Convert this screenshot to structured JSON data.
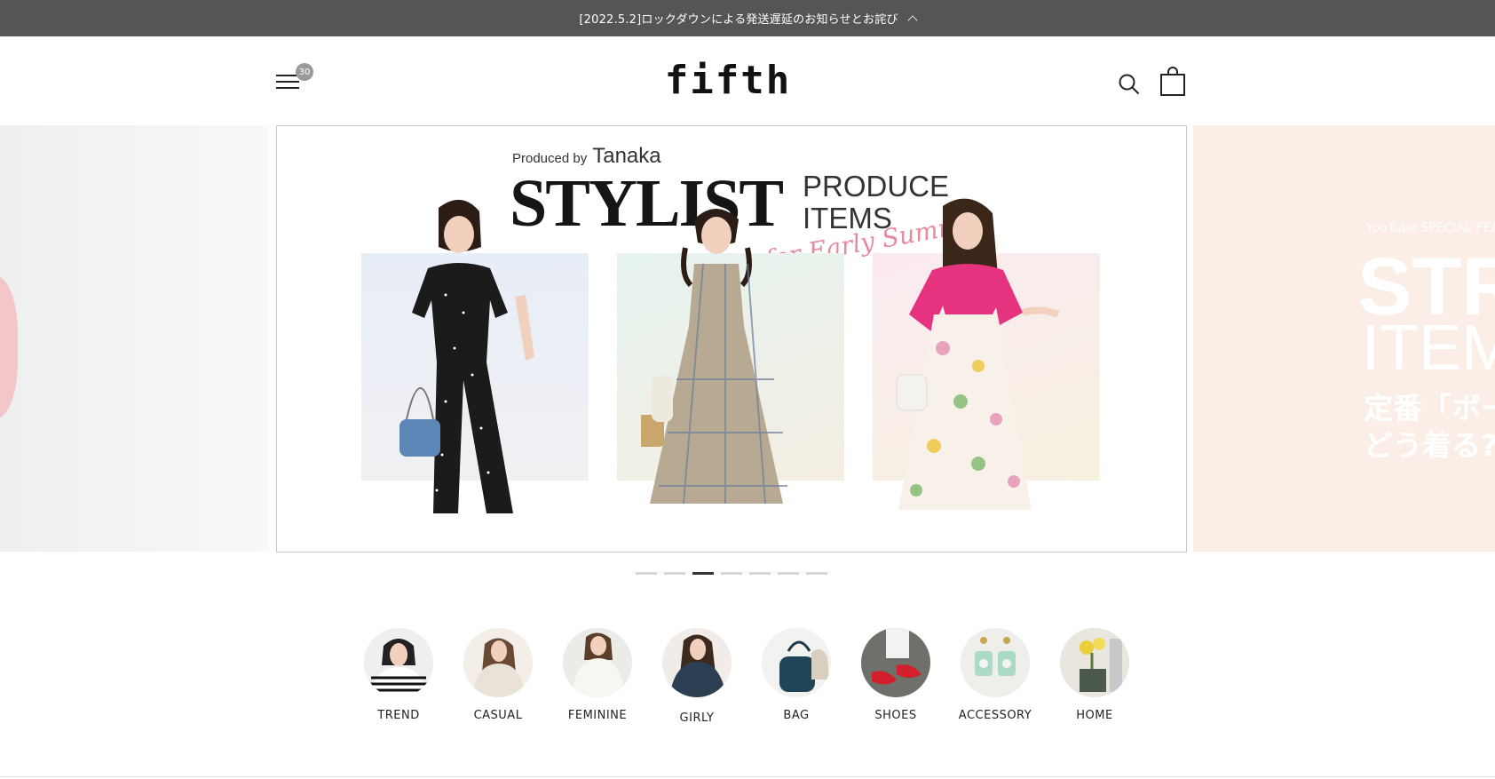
{
  "announcement": {
    "text": "[2022.5.2]ロックダウンによる発送遅延のお知らせとお詫び"
  },
  "header": {
    "logo": "fifth",
    "menu_badge": "30"
  },
  "hero": {
    "produced_by": "Produced by",
    "producer": "Tanaka",
    "headline": "STYLIST",
    "sub_1": "PRODUCE",
    "sub_2": "ITEMS",
    "script": "for Early Summer"
  },
  "next_slide": {
    "kicker": "YouTube SPECIAL FEA",
    "big_1": "STR",
    "big_2": "ITEM",
    "jp_1": "定番「ボー",
    "jp_2": "どう着る?"
  },
  "slider_dots": {
    "count": 7,
    "active_index": 2
  },
  "categories": [
    {
      "label": "TREND"
    },
    {
      "label": "CASUAL"
    },
    {
      "label": "FEMININE"
    },
    {
      "label": "GIRLY"
    },
    {
      "label": "BAG"
    },
    {
      "label": "SHOES"
    },
    {
      "label": "ACCESSORY"
    },
    {
      "label": "HOME"
    }
  ],
  "colors": {
    "announce_bg": "#555555",
    "accent_pink": "#e6337f",
    "badge": "#9a9a9a"
  }
}
